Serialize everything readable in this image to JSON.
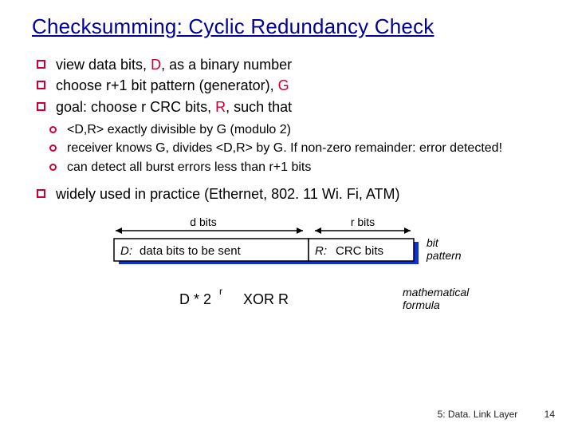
{
  "title": "Checksumming: Cyclic Redundancy Check",
  "b1": "view data bits, ",
  "b1_sym": "D",
  "b1_tail": ", as a binary number",
  "b2": "choose r+1 bit pattern (generator), ",
  "b2_sym": "G",
  "b3": "goal: choose r CRC bits, ",
  "b3_sym": "R",
  "b3_tail": ", such that",
  "s1": "<D,R> exactly divisible by G (modulo 2)",
  "s2": "receiver knows G, divides <D,R> by G.  If non-zero remainder: error detected!",
  "s3": "can detect all burst errors less than r+1 bits",
  "b4": "widely used in practice (Ethernet, 802. 11 Wi. Fi, ATM)",
  "diagram": {
    "dbits": "d bits",
    "rbits": "r bits",
    "dlabel": "D:",
    "dtext": "data bits to be sent",
    "rlabel": "R:",
    "rtext": "CRC bits",
    "bit_pattern": "bit pattern",
    "formula_left": "D * 2",
    "formula_exp": "r",
    "formula_mid": "XOR   R",
    "math_label": "mathematical formula"
  },
  "footer": {
    "section": "5: Data. Link Layer",
    "page": "14"
  }
}
